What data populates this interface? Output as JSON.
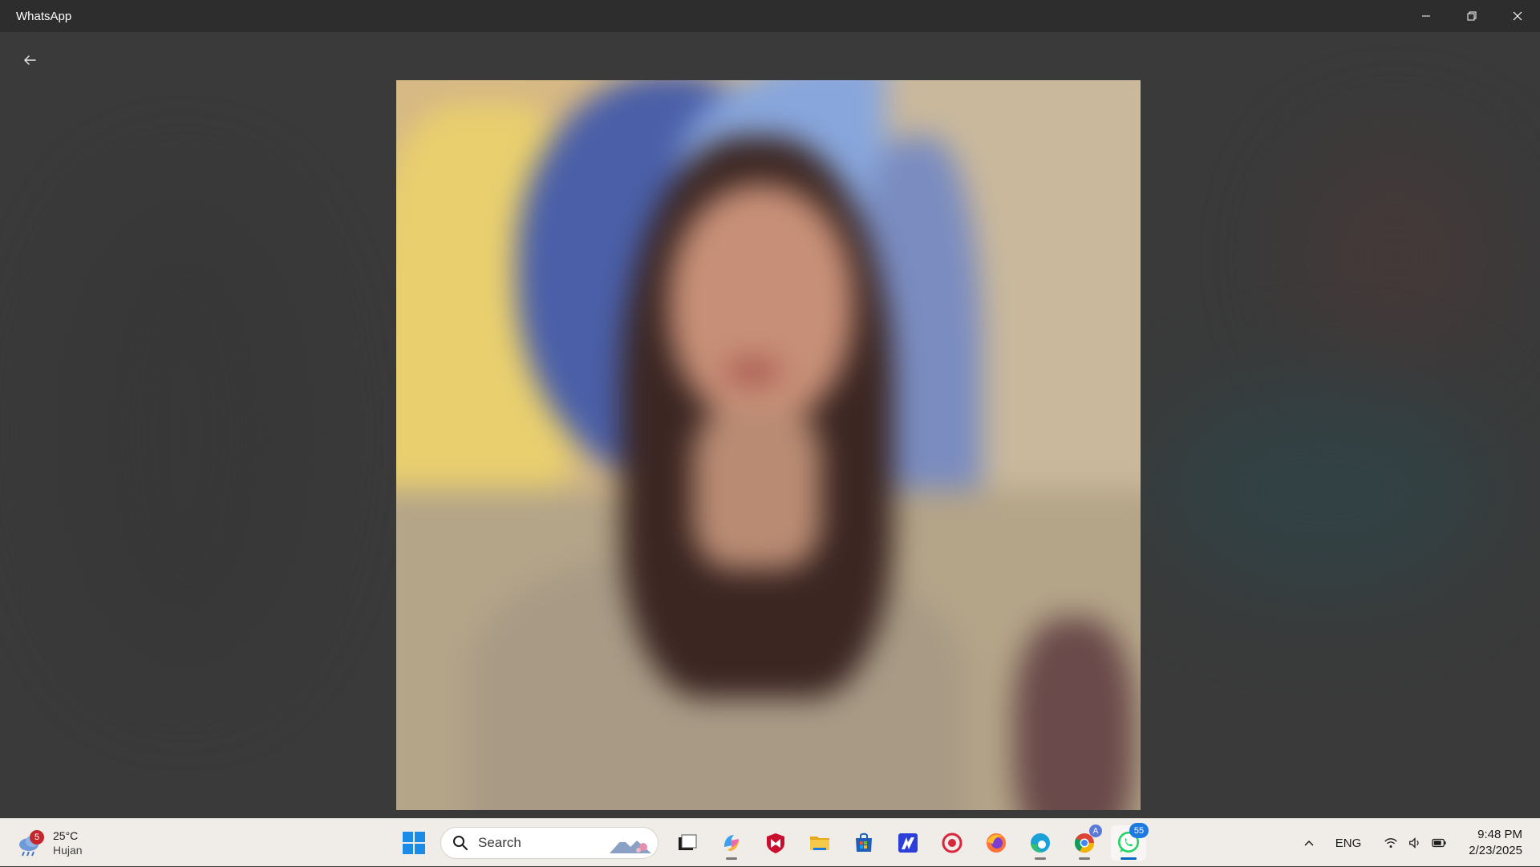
{
  "window": {
    "title": "WhatsApp",
    "controls": [
      "minimize-icon",
      "restore-icon",
      "close-icon"
    ]
  },
  "viewer": {
    "back_icon": "arrow-left-icon",
    "media_type": "photo"
  },
  "taskbar": {
    "weather": {
      "temperature": "25°C",
      "condition": "Hujan",
      "alert_count": "5",
      "icon": "rain-cloud-icon"
    },
    "search": {
      "label": "Search",
      "icon": "search-icon"
    },
    "apps": [
      {
        "name": "start",
        "icon": "windows-logo-icon"
      },
      {
        "name": "task-view",
        "icon": "task-view-icon"
      },
      {
        "name": "copilot",
        "icon": "copilot-icon"
      },
      {
        "name": "mcafee",
        "icon": "mcafee-icon"
      },
      {
        "name": "file-explorer",
        "icon": "folder-icon"
      },
      {
        "name": "microsoft-store",
        "icon": "store-icon"
      },
      {
        "name": "app-blue",
        "icon": "app-blue-icon"
      },
      {
        "name": "screen-recorder",
        "icon": "record-icon"
      },
      {
        "name": "firefox",
        "icon": "firefox-icon"
      },
      {
        "name": "edge",
        "icon": "edge-icon"
      },
      {
        "name": "chrome",
        "icon": "chrome-icon",
        "badge": "A"
      },
      {
        "name": "whatsapp",
        "icon": "whatsapp-icon",
        "badge": "55",
        "active": true
      }
    ],
    "tray": {
      "language": "ENG",
      "time": "9:48 PM",
      "date": "2/23/2025",
      "icons": [
        "chevron-up-icon",
        "wifi-icon",
        "volume-icon",
        "battery-icon"
      ]
    }
  },
  "colors": {
    "titlebar_bg": "#2d2d2d",
    "viewer_bg": "#3a3a3a",
    "taskbar_bg": "#f0ece8",
    "accent": "#0067c0",
    "whatsapp_green": "#25d366"
  }
}
